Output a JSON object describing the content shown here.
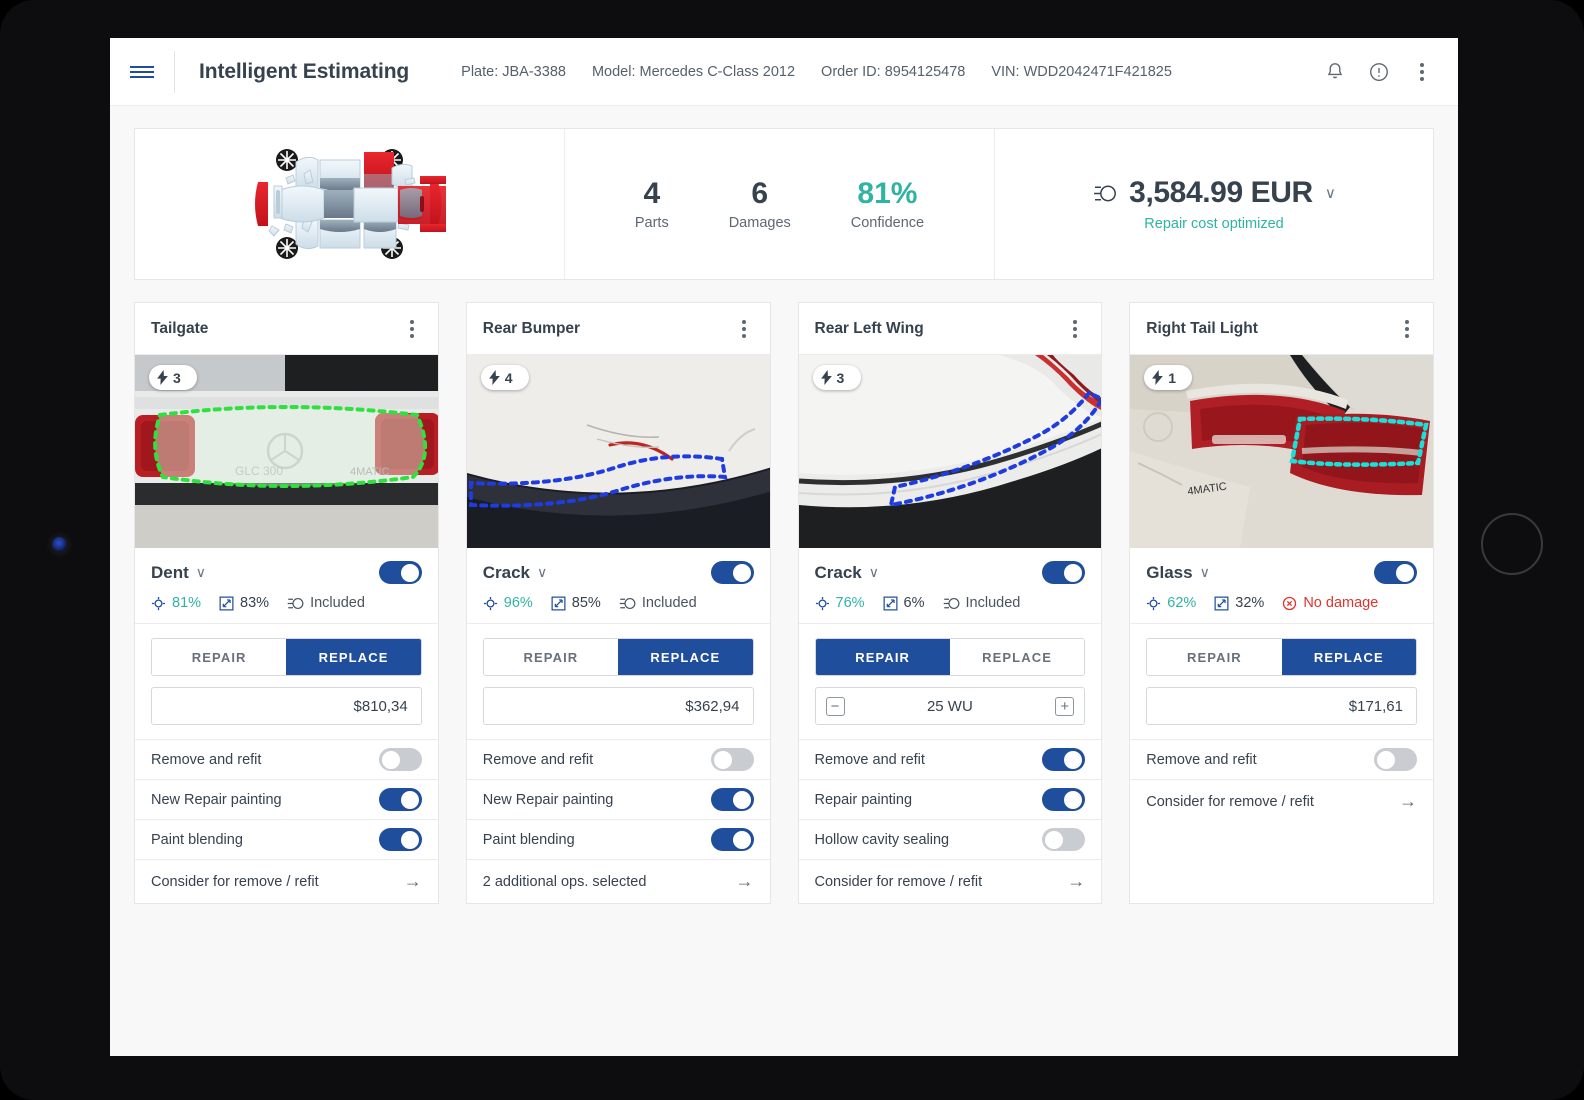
{
  "header": {
    "menu_icon": "hamburger-icon",
    "title": "Intelligent Estimating",
    "meta": [
      "Plate: JBA-3388",
      "Model: Mercedes C-Class 2012",
      "Order ID: 8954125478",
      "VIN: WDD2042471F421825"
    ],
    "icons": [
      "bell-icon",
      "info-circle-icon",
      "kebab-menu-icon"
    ]
  },
  "summary": {
    "vehicle_diagram": "exploded-car-parts-diagram",
    "stats": [
      {
        "value": "4",
        "label": "Parts",
        "accent": false
      },
      {
        "value": "6",
        "label": "Damages",
        "accent": false
      },
      {
        "value": "81%",
        "label": "Confidence",
        "accent": true
      }
    ],
    "cost": {
      "icon": "coin-stack-icon",
      "value": "3,584.99 EUR",
      "caret": "∨",
      "subtitle": "Repair cost optimized"
    }
  },
  "labels": {
    "repair": "REPAIR",
    "replace": "REPLACE",
    "included": "Included",
    "no_damage": "No damage",
    "minus": "−",
    "plus": "+",
    "arrow": "→",
    "caret": "∨"
  },
  "cards": [
    {
      "title": "Tailgate",
      "badge_count": "3",
      "damage_type": "Dent",
      "damage_enabled": true,
      "confidence": "81%",
      "severity": "83%",
      "cost_status": "Included",
      "cost_status_type": "included",
      "mode": "replace",
      "value": "$810,34",
      "value_type": "price",
      "options": [
        {
          "label": "Remove and refit",
          "on": false
        },
        {
          "label": "New Repair painting",
          "on": true
        },
        {
          "label": "Paint blending",
          "on": true
        }
      ],
      "footer_link": "Consider for remove / refit",
      "outline_color": "#2fe03f",
      "photo": "tailgate-damage-photo"
    },
    {
      "title": "Rear Bumper",
      "badge_count": "4",
      "damage_type": "Crack",
      "damage_enabled": true,
      "confidence": "96%",
      "severity": "85%",
      "cost_status": "Included",
      "cost_status_type": "included",
      "mode": "replace",
      "value": "$362,94",
      "value_type": "price",
      "options": [
        {
          "label": "Remove and refit",
          "on": false
        },
        {
          "label": "New Repair painting",
          "on": true
        },
        {
          "label": "Paint blending",
          "on": true
        }
      ],
      "footer_link": "2 additional ops. selected",
      "outline_color": "#1f3ce0",
      "photo": "rear-bumper-damage-photo"
    },
    {
      "title": "Rear Left Wing",
      "badge_count": "3",
      "damage_type": "Crack",
      "damage_enabled": true,
      "confidence": "76%",
      "severity": "6%",
      "cost_status": "Included",
      "cost_status_type": "included",
      "mode": "repair",
      "value": "25 WU",
      "value_type": "stepper",
      "options": [
        {
          "label": "Remove and refit",
          "on": true
        },
        {
          "label": "Repair painting",
          "on": true
        },
        {
          "label": "Hollow cavity sealing",
          "on": false
        }
      ],
      "footer_link": "Consider for remove / refit",
      "outline_color": "#1f3ce0",
      "photo": "rear-left-wing-damage-photo"
    },
    {
      "title": "Right Tail Light",
      "badge_count": "1",
      "damage_type": "Glass",
      "damage_enabled": true,
      "confidence": "62%",
      "severity": "32%",
      "cost_status": "No damage",
      "cost_status_type": "no-damage",
      "mode": "replace",
      "value": "$171,61",
      "value_type": "price",
      "options": [
        {
          "label": "Remove and refit",
          "on": false
        }
      ],
      "footer_link": "Consider for remove / refit",
      "outline_color": "#19e0d8",
      "photo": "right-tail-light-damage-photo"
    }
  ],
  "colors": {
    "primary_blue": "#1f4e9c",
    "teal": "#2fb3a3",
    "red": "#e0342b",
    "text_dark": "#36424e"
  }
}
